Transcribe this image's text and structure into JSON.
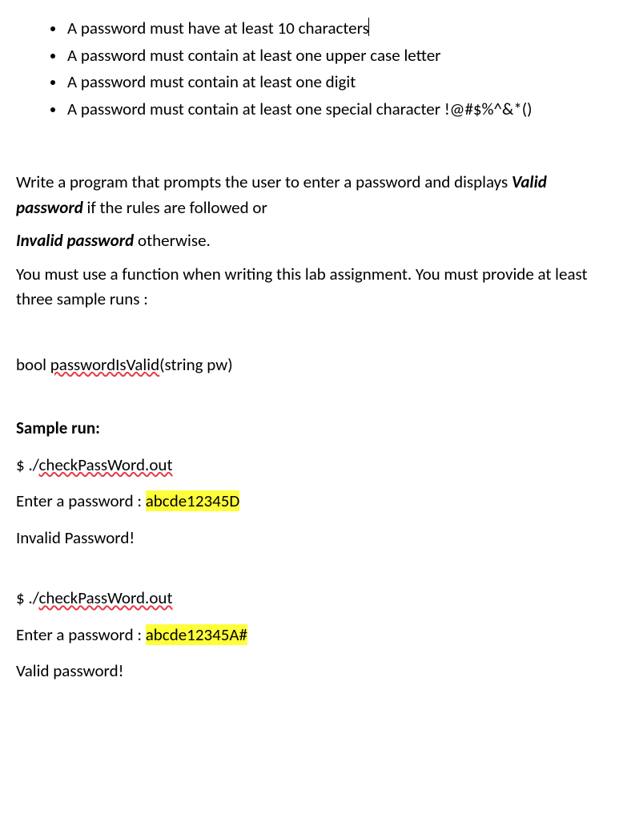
{
  "rules": [
    {
      "text_before_cursor": "A password must have at least 10 characters",
      "has_cursor": true
    },
    {
      "text": "A password must contain at least one upper case letter"
    },
    {
      "text": "A password must contain at least one digit"
    },
    {
      "text": "A password must contain at least one special character !@#$%^&*()"
    }
  ],
  "para1_pre": "Write a program that prompts the user to enter a password and displays ",
  "para1_bold": "Valid password",
  "para1_post": " if the rules are followed or",
  "para2_bold": " Invalid password",
  "para2_post": " otherwise.",
  "para3": "You must use a function when writing this lab assignment. You must provide at least three sample runs :",
  "func_pre": "bool   ",
  "func_spell": "passwordIsValid",
  "func_post": "(string   pw)",
  "sample_heading": "Sample run:",
  "run1": {
    "cmd_pre": "$   ./",
    "cmd_spell": "checkPassWord.out",
    "prompt_pre": "Enter a password  :  ",
    "input": "abcde12345D",
    "result": "Invalid Password!"
  },
  "run2": {
    "cmd_pre": "$  ./",
    "cmd_spell": "checkPassWord.out",
    "prompt_pre": "Enter a password  :  ",
    "input": "abcde12345A#",
    "result": "Valid password!"
  }
}
